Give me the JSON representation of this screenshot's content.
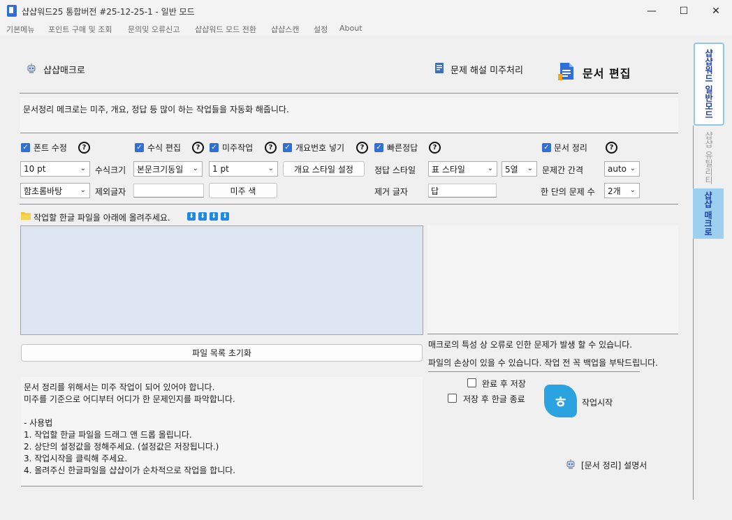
{
  "window": {
    "title": "샵샵워드25 통합버전 #25-12-25-1 - 일반 모드",
    "minimize": "—",
    "maximize": "☐",
    "close": "✕"
  },
  "menu": [
    "기본메뉴",
    "포인트 구매 및 조회",
    "문의및 오류신고",
    "샵샵워드 모드 전환",
    "샵샵스캔",
    "설정",
    "About"
  ],
  "header": {
    "macro_label": "샵샵매크로",
    "unprocessed_label": "문제 해설 미주처리",
    "doc_edit_title": "문서 편집"
  },
  "description": "문서정리 메크로는 미주, 개요, 정답 등 많이 하는 작업들을 자동화 해줍니다.",
  "options": {
    "font_fix": "폰트 수정",
    "formula_edit": "수식 편집",
    "endnote_work": "미주작업",
    "outline_number": "개요번호 넣기",
    "quick_answer": "빠른정답",
    "doc_arrange": "문서 정리",
    "help": "?"
  },
  "settings": {
    "font_size": "10 pt",
    "formula_size_label": "수식크기",
    "formula_size": "본문크기동일",
    "endnote_size": "1 pt",
    "outline_style_btn": "개요 스타일 설정",
    "answer_style_label": "정답 스타일",
    "answer_style": "표 스타일",
    "columns": "5열",
    "question_gap_label": "문제간 간격",
    "question_gap": "auto",
    "font_name": "함초롬바탕",
    "exclude_chars_label": "제외글자",
    "exclude_chars": "",
    "endnote_color_btn": "미주 색",
    "remove_chars_label": "제거 글자",
    "remove_chars": "답",
    "questions_per_col_label": "한 단의 문제 수",
    "questions_per_col": "2개"
  },
  "upload": {
    "prompt": "작업할 한글 파일을 아래에 올려주세요.",
    "arrows": [
      "⬇",
      "⬇",
      "⬇",
      "⬇"
    ],
    "reset_btn": "파일 목록 초기화"
  },
  "warnings": [
    "매크로의 특성 상 오류로 인한 문제가 발생 할 수 있습니다.",
    "파일의 손상이 있을 수 있습니다. 작업 전 꼭 백업을 부탁드립니다."
  ],
  "instructions": [
    "문서 정리를 위해서는 미주 작업이 되어 있어야 합니다.",
    "미주를 기준으로 어디부터 어디가 한 문제인지를 파악합니다.",
    "",
    "- 사용법",
    "1. 작업할 한글 파일을 드래그 앤 드롭 올립니다.",
    "2. 상단의 설정값을 정해주세요. (설정값은 저장됩니다.)",
    "3. 작업시작을 클릭해 주세요.",
    "4. 올려주신 한글파일을 샵샵이가 순차적으로 작업을 합니다."
  ],
  "actions": {
    "save_after": "완료 후 저장",
    "close_after": "저장 후 한글 종료",
    "hwp_icon_letter": "ㅎ",
    "start": "작업시작",
    "manual": "[문서 정리] 설명서"
  },
  "sidebar": {
    "tabs": [
      "샵샵워드 일반모드",
      "샵샵 유틸리티",
      "샵샵 매크로"
    ]
  },
  "colors": {
    "accent": "#2f6fd6",
    "sidebar_active": "#9dd0f0",
    "dropzone": "#dde5f0"
  }
}
